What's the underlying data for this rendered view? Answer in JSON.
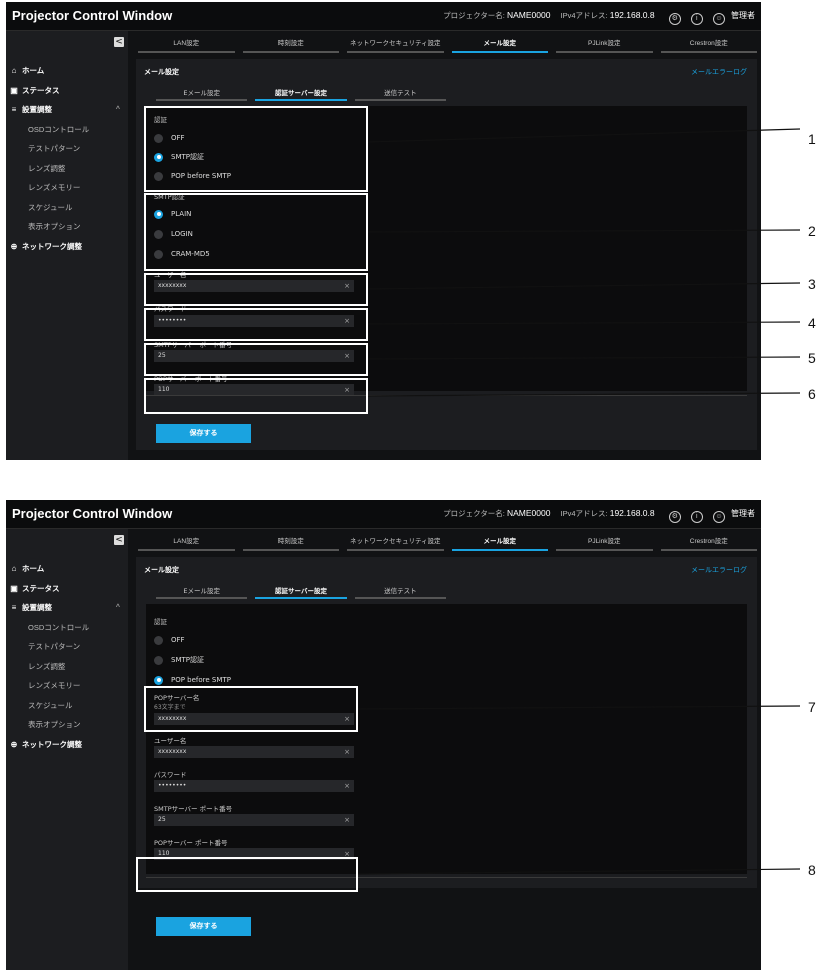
{
  "app": {
    "title": "Projector Control Window",
    "projector_label": "プロジェクター名:",
    "projector_name": "NAME0000",
    "ip_label": "IPv4アドレス:",
    "ip_address": "192.168.0.8",
    "user": "管理者"
  },
  "sidebar": {
    "collapse_glyph": "<",
    "home": "ホーム",
    "status": "ステータス",
    "settings": "設置調整",
    "items": [
      "OSDコントロール",
      "テストパターン",
      "レンズ調整",
      "レンズメモリー",
      "スケジュール",
      "表示オプション"
    ],
    "network": "ネットワーク調整"
  },
  "tabs": [
    "LAN設定",
    "時刻設定",
    "ネットワークセキュリティ設定",
    "メール設定",
    "PJLink設定",
    "Crestron設定"
  ],
  "mail": {
    "title": "メール設定",
    "error_log": "メールエラーログ",
    "subtabs": [
      "Eメール設定",
      "認証サーバー設定",
      "送信テスト"
    ],
    "auth_label": "認証",
    "auth_options": [
      "OFF",
      "SMTP認証",
      "POP before SMTP"
    ],
    "smtp_auth_label": "SMTP認証",
    "smtp_auth_options": [
      "PLAIN",
      "LOGIN",
      "CRAM-MD5"
    ],
    "pop_server_label": "POPサーバー名",
    "pop_server_hint": "63文字まで",
    "pop_server_value": "xxxxxxxx",
    "username_label": "ユーザー名",
    "username_value": "xxxxxxxx",
    "password_label": "パスワード",
    "password_value": "••••••••",
    "smtp_port_label": "SMTPサーバー ポート番号",
    "smtp_port_value": "25",
    "pop_port_label": "POPサーバー ポート番号",
    "pop_port_value": "110",
    "save": "保存する",
    "clear_glyph": "×"
  },
  "callouts": [
    "1",
    "2",
    "3",
    "4",
    "5",
    "6",
    "7",
    "8"
  ],
  "colors": {
    "accent": "#1aa3e0",
    "background": "#111214",
    "panel": "#0c0c0d"
  }
}
